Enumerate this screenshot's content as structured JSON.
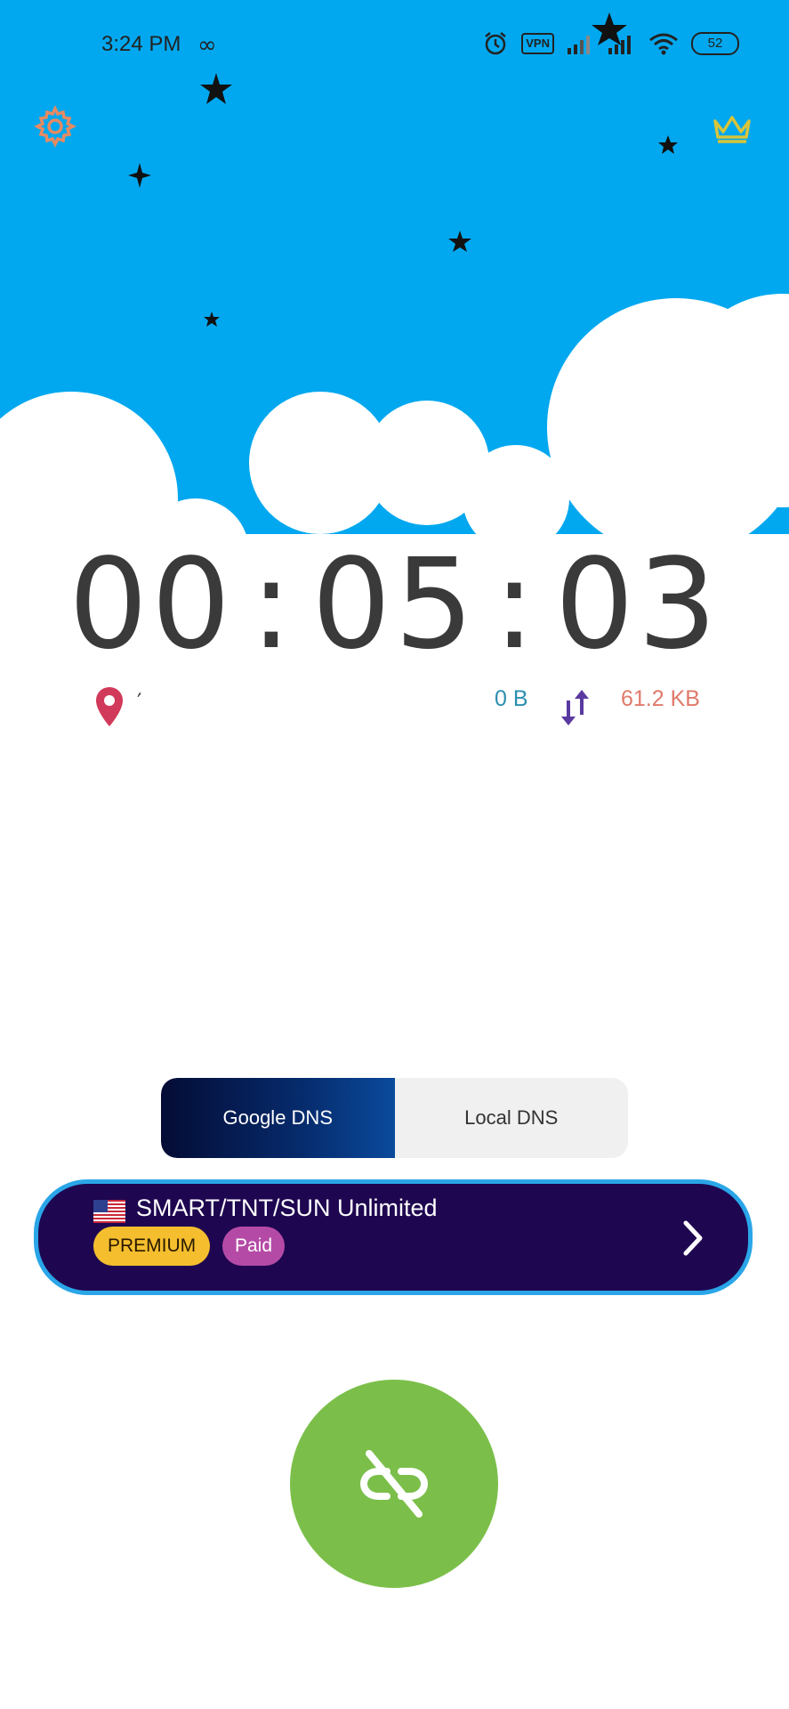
{
  "status_bar": {
    "time": "3:24 PM",
    "infinity_symbol": "∞",
    "vpn_label": "VPN",
    "battery_level": "52",
    "icons": [
      "infinity-icon",
      "alarm-icon",
      "vpn-icon",
      "signal-icon",
      "signal-icon",
      "wifi-icon",
      "battery-icon"
    ]
  },
  "header": {
    "settings_icon": "gear-icon",
    "premium_icon": "crown-icon",
    "settings_color": "#e58a63",
    "crown_color": "#d8c43a"
  },
  "colors": {
    "sky": "#02a8ef",
    "cloud": "#ffffff",
    "timer_text": "#3a3a3a",
    "download": "#2b8fb0",
    "upload": "#e07a6a",
    "location_pin": "#d13a5a",
    "connect_button": "#7bbf4a",
    "server_card_bg": "#1e0650",
    "server_card_border": "#2aa6e8",
    "premium_badge": "#f5be2e",
    "paid_badge": "#b54aa6"
  },
  "timer": {
    "hours": "00",
    "minutes": "05",
    "seconds": "03",
    "separator": ":"
  },
  "stats": {
    "location_icon": "map-pin-icon",
    "location_text": "′",
    "download": "0 B",
    "traffic_icon": "up-down-arrows-icon",
    "upload": "61.2 KB"
  },
  "dns": {
    "options": [
      "Google DNS",
      "Local DNS"
    ],
    "selected": "Google DNS"
  },
  "server": {
    "flag_icon": "us-flag-icon",
    "name": "SMART/TNT/SUN Unlimited",
    "badges": [
      "PREMIUM",
      "Paid"
    ],
    "chevron_icon": "chevron-right-icon"
  },
  "connect_button": {
    "icon": "link-off-icon"
  }
}
